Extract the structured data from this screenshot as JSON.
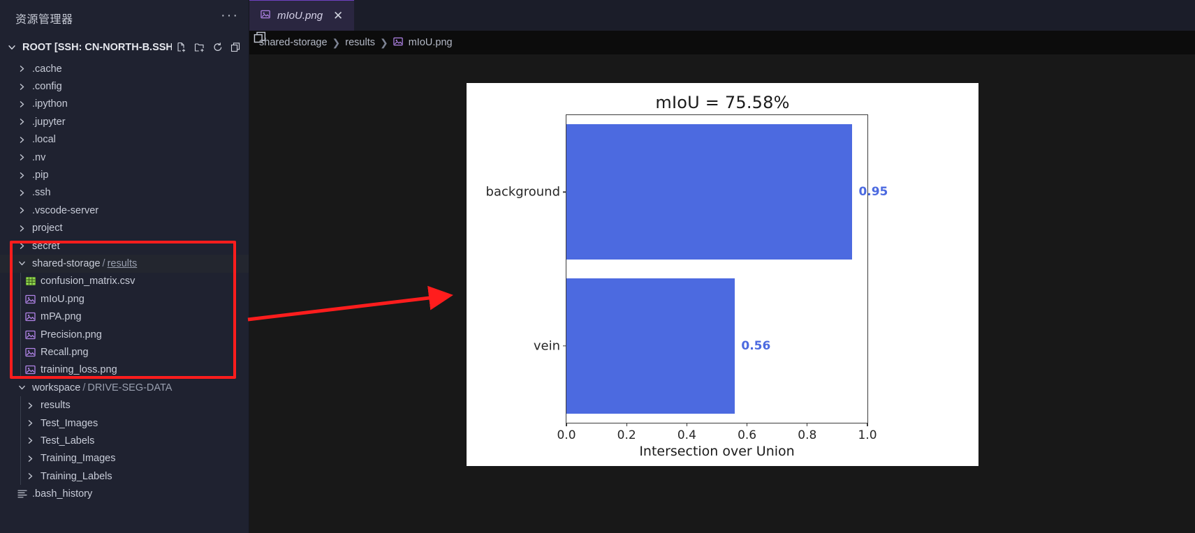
{
  "sidebar": {
    "title": "资源管理器",
    "more_label": "···",
    "root": {
      "label": "ROOT [SSH: CN-NORTH-B.SSH.DA...",
      "actions": [
        "new-file-icon",
        "new-folder-icon",
        "refresh-icon",
        "collapse-all-icon"
      ]
    },
    "items": [
      {
        "label": ".cache",
        "kind": "folder",
        "depth": 1,
        "expanded": false,
        "selected": false
      },
      {
        "label": ".config",
        "kind": "folder",
        "depth": 1,
        "expanded": false,
        "selected": false
      },
      {
        "label": ".ipython",
        "kind": "folder",
        "depth": 1,
        "expanded": false,
        "selected": false
      },
      {
        "label": ".jupyter",
        "kind": "folder",
        "depth": 1,
        "expanded": false,
        "selected": false
      },
      {
        "label": ".local",
        "kind": "folder",
        "depth": 1,
        "expanded": false,
        "selected": false
      },
      {
        "label": ".nv",
        "kind": "folder",
        "depth": 1,
        "expanded": false,
        "selected": false
      },
      {
        "label": ".pip",
        "kind": "folder",
        "depth": 1,
        "expanded": false,
        "selected": false
      },
      {
        "label": ".ssh",
        "kind": "folder",
        "depth": 1,
        "expanded": false,
        "selected": false
      },
      {
        "label": ".vscode-server",
        "kind": "folder",
        "depth": 1,
        "expanded": false,
        "selected": false
      },
      {
        "label": "project",
        "kind": "folder",
        "depth": 1,
        "expanded": false,
        "selected": false
      },
      {
        "label": "secret",
        "kind": "folder",
        "depth": 1,
        "expanded": false,
        "selected": false
      },
      {
        "label": "shared-storage",
        "sublabel": "results",
        "kind": "folder",
        "depth": 1,
        "expanded": true,
        "selected": true
      },
      {
        "label": "confusion_matrix.csv",
        "kind": "csv",
        "depth": 2,
        "selected": false
      },
      {
        "label": "mIoU.png",
        "kind": "image",
        "depth": 2,
        "selected": false
      },
      {
        "label": "mPA.png",
        "kind": "image",
        "depth": 2,
        "selected": false
      },
      {
        "label": "Precision.png",
        "kind": "image",
        "depth": 2,
        "selected": false
      },
      {
        "label": "Recall.png",
        "kind": "image",
        "depth": 2,
        "selected": false
      },
      {
        "label": "training_loss.png",
        "kind": "image",
        "depth": 2,
        "selected": false
      },
      {
        "label": "workspace",
        "sublabel": "DRIVE-SEG-DATA",
        "kind": "folder",
        "depth": 1,
        "expanded": true,
        "selected": false
      },
      {
        "label": "results",
        "kind": "folder",
        "depth": 2,
        "expanded": false,
        "selected": false
      },
      {
        "label": "Test_Images",
        "kind": "folder",
        "depth": 2,
        "expanded": false,
        "selected": false
      },
      {
        "label": "Test_Labels",
        "kind": "folder",
        "depth": 2,
        "expanded": false,
        "selected": false
      },
      {
        "label": "Training_Images",
        "kind": "folder",
        "depth": 2,
        "expanded": false,
        "selected": false
      },
      {
        "label": "Training_Labels",
        "kind": "folder",
        "depth": 2,
        "expanded": false,
        "selected": false
      },
      {
        "label": ".bash_history",
        "kind": "text",
        "depth": 1,
        "selected": false
      }
    ]
  },
  "editor": {
    "tab": {
      "label": "mIoU.png",
      "icon": "image-file-icon",
      "close_label": "✕"
    },
    "split_icon": "split-editor-icon",
    "breadcrumb": {
      "parts": [
        "shared-storage",
        "results",
        "mIoU.png"
      ],
      "separator": "❯",
      "file_icon": "image-file-icon"
    }
  },
  "annotation": {
    "box_color": "#ff1d1d",
    "arrow_color": "#ff1d1d"
  },
  "chart_data": {
    "type": "bar",
    "orientation": "horizontal",
    "title": "mIoU = 75.58%",
    "xlabel": "Intersection over Union",
    "ylabel": "",
    "categories": [
      "background",
      "vein"
    ],
    "values": [
      0.95,
      0.56
    ],
    "value_labels": [
      "0.95",
      "0.56"
    ],
    "xlim": [
      0.0,
      1.0
    ],
    "xticks": [
      "0.0",
      "0.2",
      "0.4",
      "0.6",
      "0.8",
      "1.0"
    ],
    "xtick_values": [
      0.0,
      0.2,
      0.4,
      0.6,
      0.8,
      1.0
    ],
    "bar_color": "#4c6ae0",
    "label_color": "#4c6ae0",
    "grid": false,
    "legend": null
  }
}
